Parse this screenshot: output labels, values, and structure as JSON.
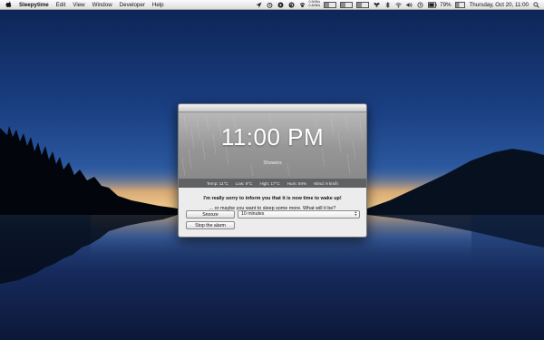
{
  "menubar": {
    "app_name": "Sleepytime",
    "menus": [
      "Edit",
      "View",
      "Window",
      "Developer",
      "Help"
    ],
    "netrate_up": "0.5KB/s",
    "netrate_down": "0.4KB/s",
    "battery": "79%",
    "clock": "Thursday, Oct 20, 11:00"
  },
  "alarm": {
    "time": "11:00 PM",
    "condition": "Showers",
    "stats": {
      "temp": "Temp: 11°C",
      "low": "Low: 9°C",
      "high": "High: 17°C",
      "hum": "Hum: 94%",
      "wind": "Wind: 9 km/h"
    },
    "message_primary": "I'm really sorry to inform you that it is now time to wake up!",
    "message_secondary": "... or maybe you want to sleep some more. What will it be?",
    "snooze_label": "Snooze",
    "snooze_duration": "10 minutes",
    "stop_label": "Stop the alarm"
  },
  "colors": {
    "sky_top": "#0e2558",
    "horizon_glow": "#e8b070",
    "weather_panel": "#9a9a9a",
    "stats_bar": "#5f6163"
  }
}
